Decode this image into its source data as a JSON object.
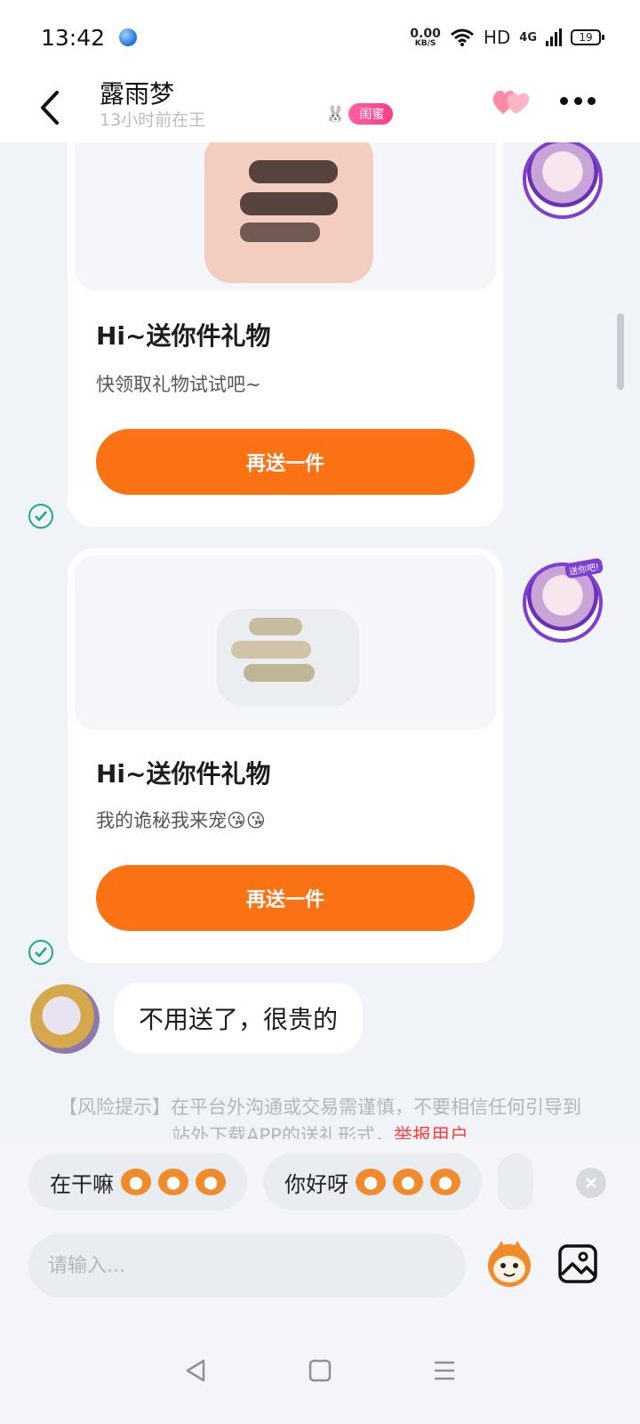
{
  "status_bar": {
    "time": "13:42",
    "net_speed_value": "0.00",
    "net_speed_unit": "KB/S",
    "hd": "HD",
    "network": "4G",
    "battery": "19"
  },
  "header": {
    "contact_name": "露雨梦",
    "presence": "13小时前在王",
    "relation_badge": "闺蜜"
  },
  "gifts": [
    {
      "title": "Hi~送你件礼物",
      "message": "快领取礼物试试吧~",
      "button_label": "再送一件"
    },
    {
      "title": "Hi~送你件礼物",
      "message": "我的诡秘我来宠😘😘",
      "button_label": "再送一件"
    }
  ],
  "avatar_tag": "送你吧!",
  "incoming_message": "不用送了，很贵的",
  "risk_notice": {
    "text": "【风险提示】在平台外沟通或交易需谨慎，不要相信任何引导到站外下载APP的送礼形式，",
    "report_link": "举报用户"
  },
  "quick_replies": [
    {
      "label": "在干嘛",
      "emoji_count": 3
    },
    {
      "label": "你好呀",
      "emoji_count": 3
    }
  ],
  "input": {
    "placeholder": "请输入..."
  },
  "colors": {
    "accent_orange": "#fb7214",
    "badge_pink": "#ff4a8f",
    "check_green": "#1aa98a",
    "report_red": "#ff3f3f"
  },
  "icons": [
    "back-arrow-icon",
    "hearts-icon",
    "more-icon",
    "check-circle-icon",
    "emoji-icon",
    "image-icon",
    "clear-icon",
    "nav-back-icon",
    "nav-home-icon",
    "nav-menu-icon"
  ]
}
